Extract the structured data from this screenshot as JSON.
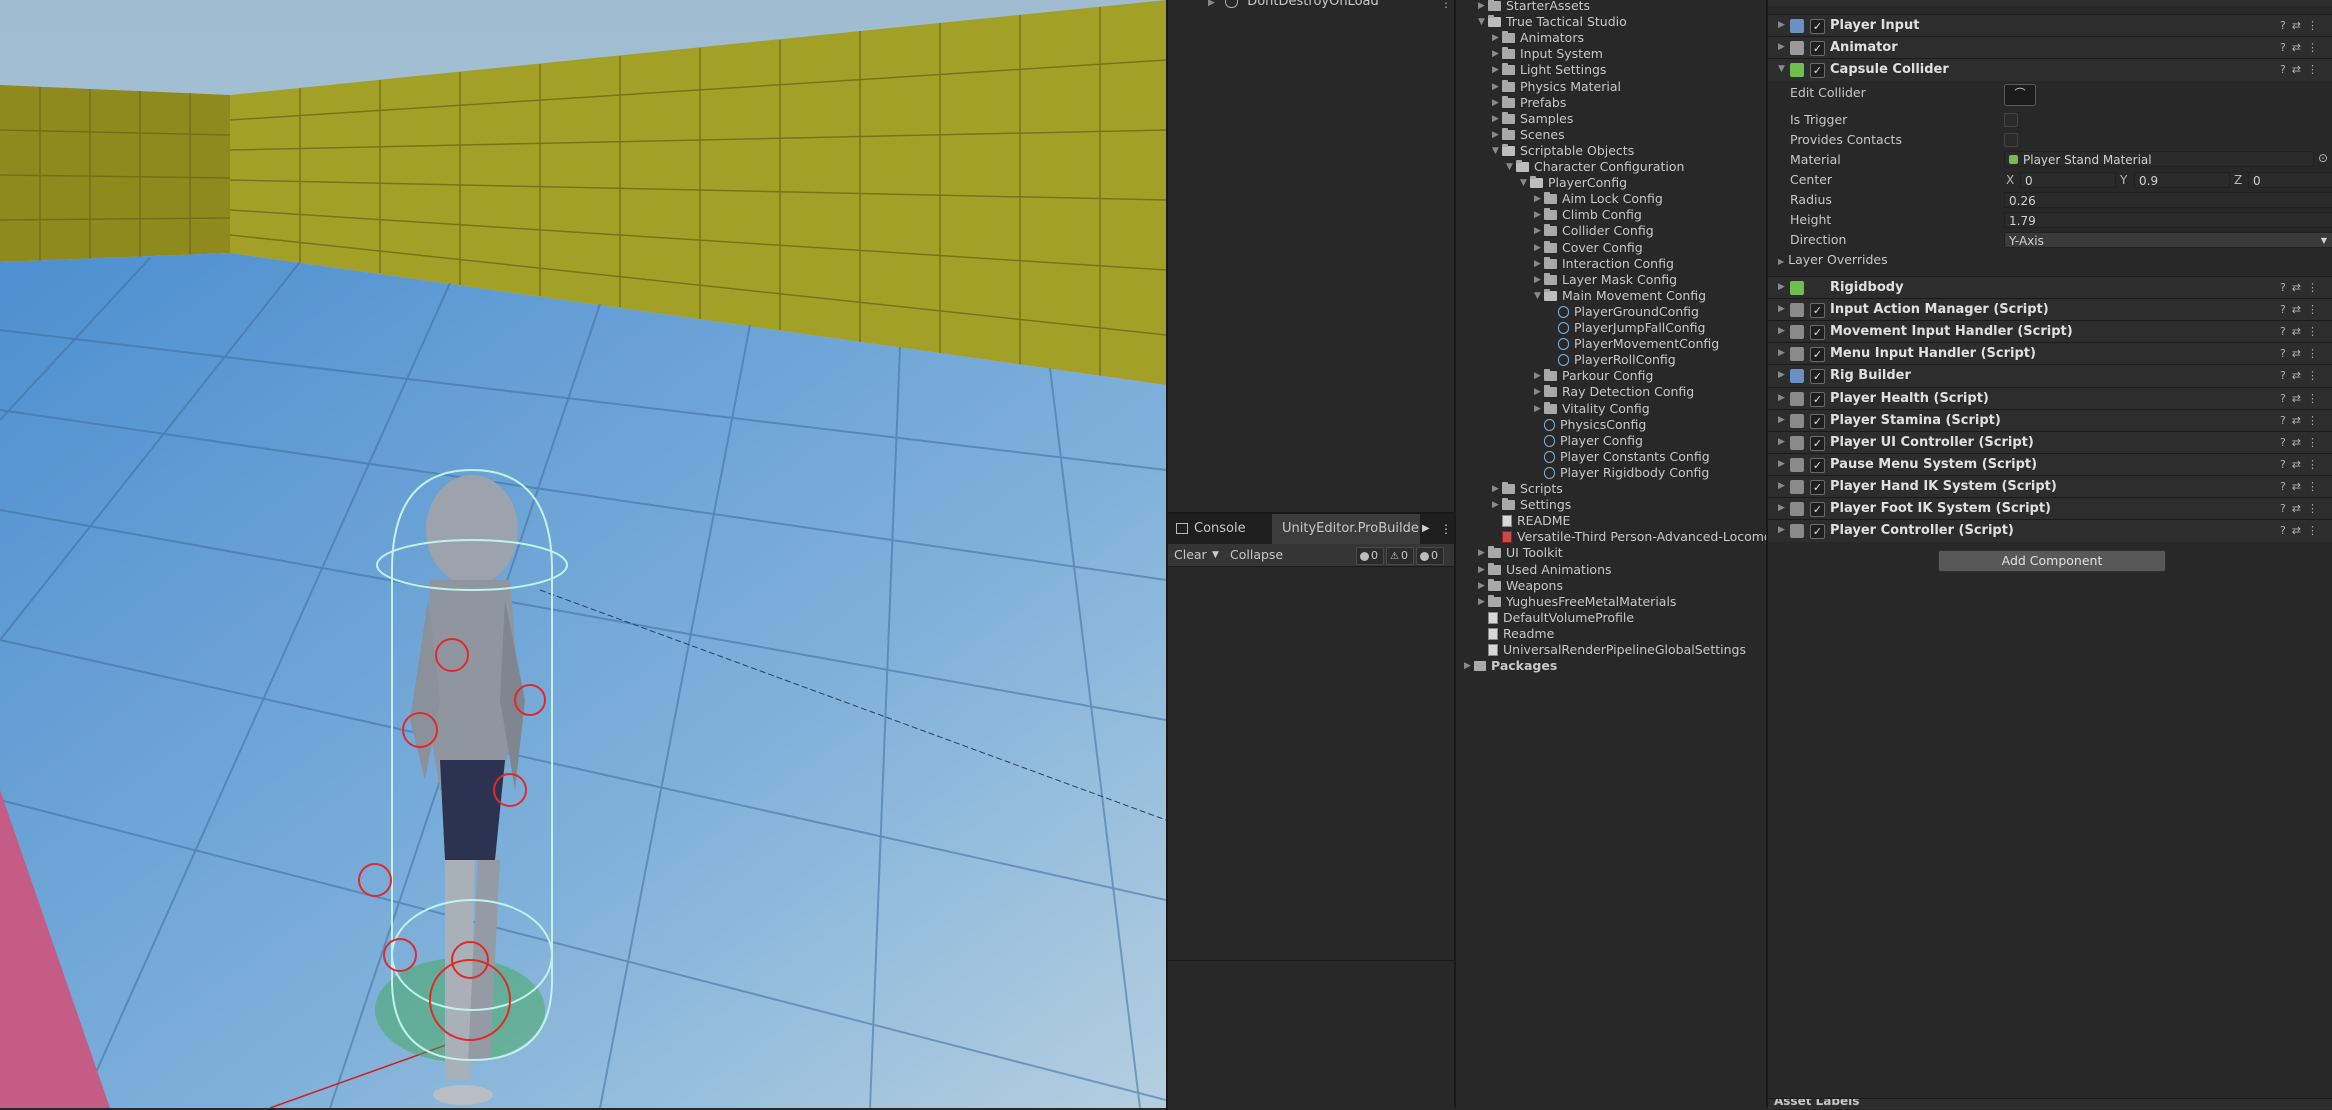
{
  "hierarchy": {
    "rows": [
      {
        "label": "DontDestroyOnLoad"
      }
    ]
  },
  "console": {
    "tabs": [
      {
        "label": "Console"
      },
      {
        "label": "UnityEditor.ProBuilder.V"
      }
    ],
    "toolbar": {
      "clear": "Clear",
      "collapse": "Collapse"
    },
    "counts": {
      "info": "0",
      "warn": "0",
      "error": "0"
    }
  },
  "project": {
    "tree": [
      {
        "label": "StarterAssets",
        "kind": "folder",
        "depth": 1,
        "open": false
      },
      {
        "label": "True Tactical Studio",
        "kind": "folder",
        "depth": 1,
        "open": true
      },
      {
        "label": "Animators",
        "kind": "folder",
        "depth": 2,
        "open": false
      },
      {
        "label": "Input System",
        "kind": "folder",
        "depth": 2,
        "open": false
      },
      {
        "label": "Light Settings",
        "kind": "folder",
        "depth": 2,
        "open": false
      },
      {
        "label": "Physics Material",
        "kind": "folder",
        "depth": 2,
        "open": false
      },
      {
        "label": "Prefabs",
        "kind": "folder",
        "depth": 2,
        "open": false
      },
      {
        "label": "Samples",
        "kind": "folder",
        "depth": 2,
        "open": false
      },
      {
        "label": "Scenes",
        "kind": "folder",
        "depth": 2,
        "open": false
      },
      {
        "label": "Scriptable Objects",
        "kind": "folder",
        "depth": 2,
        "open": true
      },
      {
        "label": "Character Configuration",
        "kind": "folder",
        "depth": 3,
        "open": true
      },
      {
        "label": "PlayerConfig",
        "kind": "folder",
        "depth": 4,
        "open": true
      },
      {
        "label": "Aim Lock Config",
        "kind": "folder",
        "depth": 5,
        "open": false
      },
      {
        "label": "Climb Config",
        "kind": "folder",
        "depth": 5,
        "open": false
      },
      {
        "label": "Collider Config",
        "kind": "folder",
        "depth": 5,
        "open": false
      },
      {
        "label": "Cover Config",
        "kind": "folder",
        "depth": 5,
        "open": false
      },
      {
        "label": "Interaction Config",
        "kind": "folder",
        "depth": 5,
        "open": false
      },
      {
        "label": "Layer Mask Config",
        "kind": "folder",
        "depth": 5,
        "open": false
      },
      {
        "label": "Main Movement Config",
        "kind": "folder",
        "depth": 5,
        "open": true
      },
      {
        "label": "PlayerGroundConfig",
        "kind": "asset",
        "depth": 6
      },
      {
        "label": "PlayerJumpFallConfig",
        "kind": "asset",
        "depth": 6
      },
      {
        "label": "PlayerMovementConfig",
        "kind": "asset",
        "depth": 6
      },
      {
        "label": "PlayerRollConfig",
        "kind": "asset",
        "depth": 6
      },
      {
        "label": "Parkour Config",
        "kind": "folder",
        "depth": 5,
        "open": false
      },
      {
        "label": "Ray Detection Config",
        "kind": "folder",
        "depth": 5,
        "open": false
      },
      {
        "label": "Vitality Config",
        "kind": "folder",
        "depth": 5,
        "open": false
      },
      {
        "label": "PhysicsConfig",
        "kind": "asset",
        "depth": 5
      },
      {
        "label": "Player Config",
        "kind": "asset",
        "depth": 5
      },
      {
        "label": "Player Constants Config",
        "kind": "asset",
        "depth": 5
      },
      {
        "label": "Player Rigidbody Config",
        "kind": "asset",
        "depth": 5
      },
      {
        "label": "Scripts",
        "kind": "folder",
        "depth": 2,
        "open": false
      },
      {
        "label": "Settings",
        "kind": "folder",
        "depth": 2,
        "open": false
      },
      {
        "label": "README",
        "kind": "doc",
        "depth": 2
      },
      {
        "label": "Versatile-Third Person-Advanced-Locomoti",
        "kind": "docred",
        "depth": 2
      },
      {
        "label": "UI Toolkit",
        "kind": "folder",
        "depth": 1,
        "open": false
      },
      {
        "label": "Used Animations",
        "kind": "folder",
        "depth": 1,
        "open": false
      },
      {
        "label": "Weapons",
        "kind": "folder",
        "depth": 1,
        "open": false
      },
      {
        "label": "YughuesFreeMetalMaterials",
        "kind": "folder",
        "depth": 1,
        "open": false
      },
      {
        "label": "DefaultVolumeProfile",
        "kind": "doc",
        "depth": 1
      },
      {
        "label": "Readme",
        "kind": "doc",
        "depth": 1
      },
      {
        "label": "UniversalRenderPipelineGlobalSettings",
        "kind": "doc",
        "depth": 1
      },
      {
        "label": "Packages",
        "kind": "package",
        "depth": 0,
        "open": false
      }
    ]
  },
  "inspector": {
    "components_top": [
      {
        "name": "Player Input",
        "icon_color": "#6b8fc7"
      },
      {
        "name": "Animator",
        "icon_color": "#9a9a9a"
      },
      {
        "name": "Capsule Collider",
        "icon_color": "#6fbf4f"
      }
    ],
    "capsule": {
      "edit_collider": "Edit Collider",
      "is_trigger": "Is Trigger",
      "provides_contacts": "Provides Contacts",
      "material_label": "Material",
      "material_value": "Player Stand Material",
      "center_label": "Center",
      "center": {
        "x_label": "X",
        "x": "0",
        "y_label": "Y",
        "y": "0.9",
        "z_label": "Z",
        "z": "0"
      },
      "radius_label": "Radius",
      "radius": "0.26",
      "height_label": "Height",
      "height": "1.79",
      "direction_label": "Direction",
      "direction": "Y-Axis",
      "layer_overrides": "Layer Overrides"
    },
    "components_bottom": [
      {
        "name": "Rigidbody",
        "icon_color": "#6fbf4f",
        "checkbox": false
      },
      {
        "name": "Input Action Manager (Script)",
        "icon_color": "#8a8a8a",
        "checkbox": true
      },
      {
        "name": "Movement Input Handler (Script)",
        "icon_color": "#8a8a8a",
        "checkbox": true
      },
      {
        "name": "Menu Input Handler (Script)",
        "icon_color": "#8a8a8a",
        "checkbox": true
      },
      {
        "name": "Rig Builder",
        "icon_color": "#6b8fc7",
        "checkbox": true
      },
      {
        "name": "Player Health (Script)",
        "icon_color": "#8a8a8a",
        "checkbox": true
      },
      {
        "name": "Player Stamina (Script)",
        "icon_color": "#8a8a8a",
        "checkbox": true
      },
      {
        "name": "Player UI Controller (Script)",
        "icon_color": "#8a8a8a",
        "checkbox": true
      },
      {
        "name": "Pause Menu System (Script)",
        "icon_color": "#8a8a8a",
        "checkbox": true
      },
      {
        "name": "Player Hand IK System (Script)",
        "icon_color": "#8a8a8a",
        "checkbox": true
      },
      {
        "name": "Player Foot IK System (Script)",
        "icon_color": "#8a8a8a",
        "checkbox": true
      },
      {
        "name": "Player Controller (Script)",
        "icon_color": "#8a8a8a",
        "checkbox": true
      }
    ],
    "add_component": "Add Component",
    "asset_labels": "Asset Labels"
  }
}
